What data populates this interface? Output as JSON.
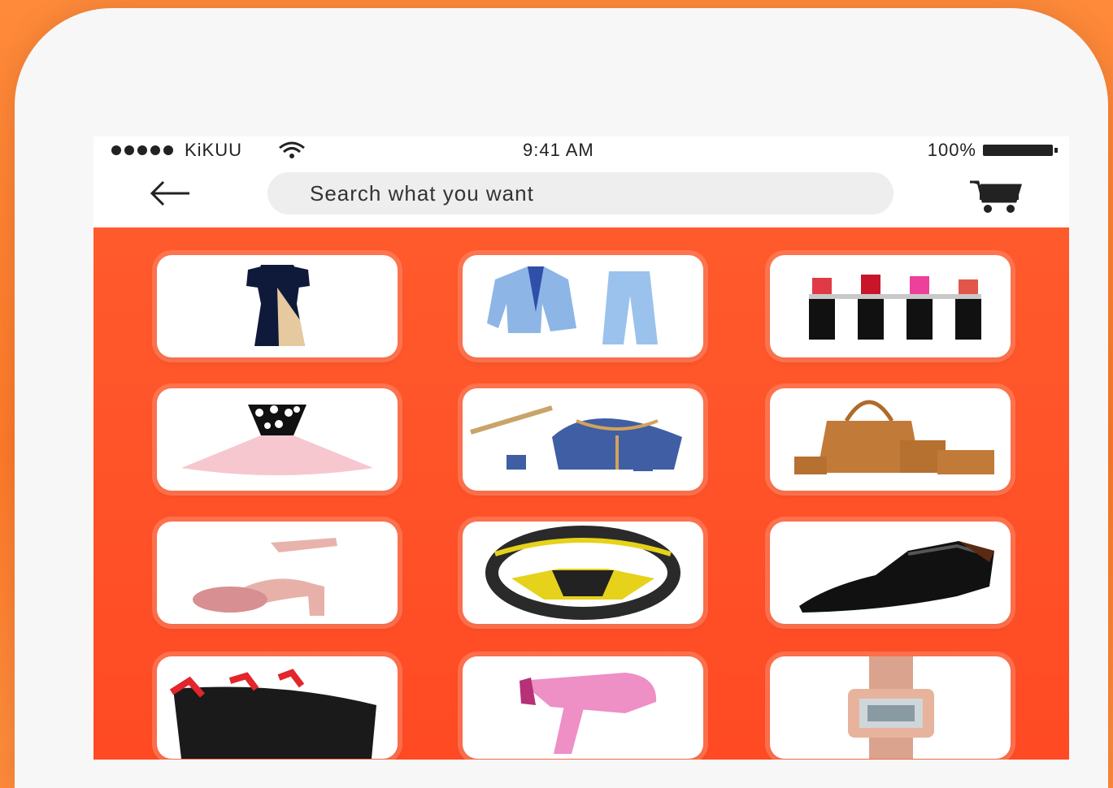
{
  "status_bar": {
    "carrier": "KiKUU",
    "time": "9:41 AM",
    "battery": "100%"
  },
  "search": {
    "placeholder": "Search what you want"
  },
  "icons": {
    "back": "arrow-left-icon",
    "cart": "shopping-cart-icon",
    "wifi": "wifi-icon",
    "battery": "battery-icon",
    "signal": "signal-dots-icon"
  },
  "colors": {
    "accent": "#ff5a2c",
    "background": "#ff8a3a"
  },
  "categories": [
    {
      "item": "dress"
    },
    {
      "item": "suit"
    },
    {
      "item": "lipstick"
    },
    {
      "item": "tutu-dress"
    },
    {
      "item": "jewelry"
    },
    {
      "item": "handbag"
    },
    {
      "item": "heels"
    },
    {
      "item": "steering-wheel"
    },
    {
      "item": "shoe"
    },
    {
      "item": "hair-extension"
    },
    {
      "item": "hair-dryer"
    },
    {
      "item": "watch"
    }
  ]
}
